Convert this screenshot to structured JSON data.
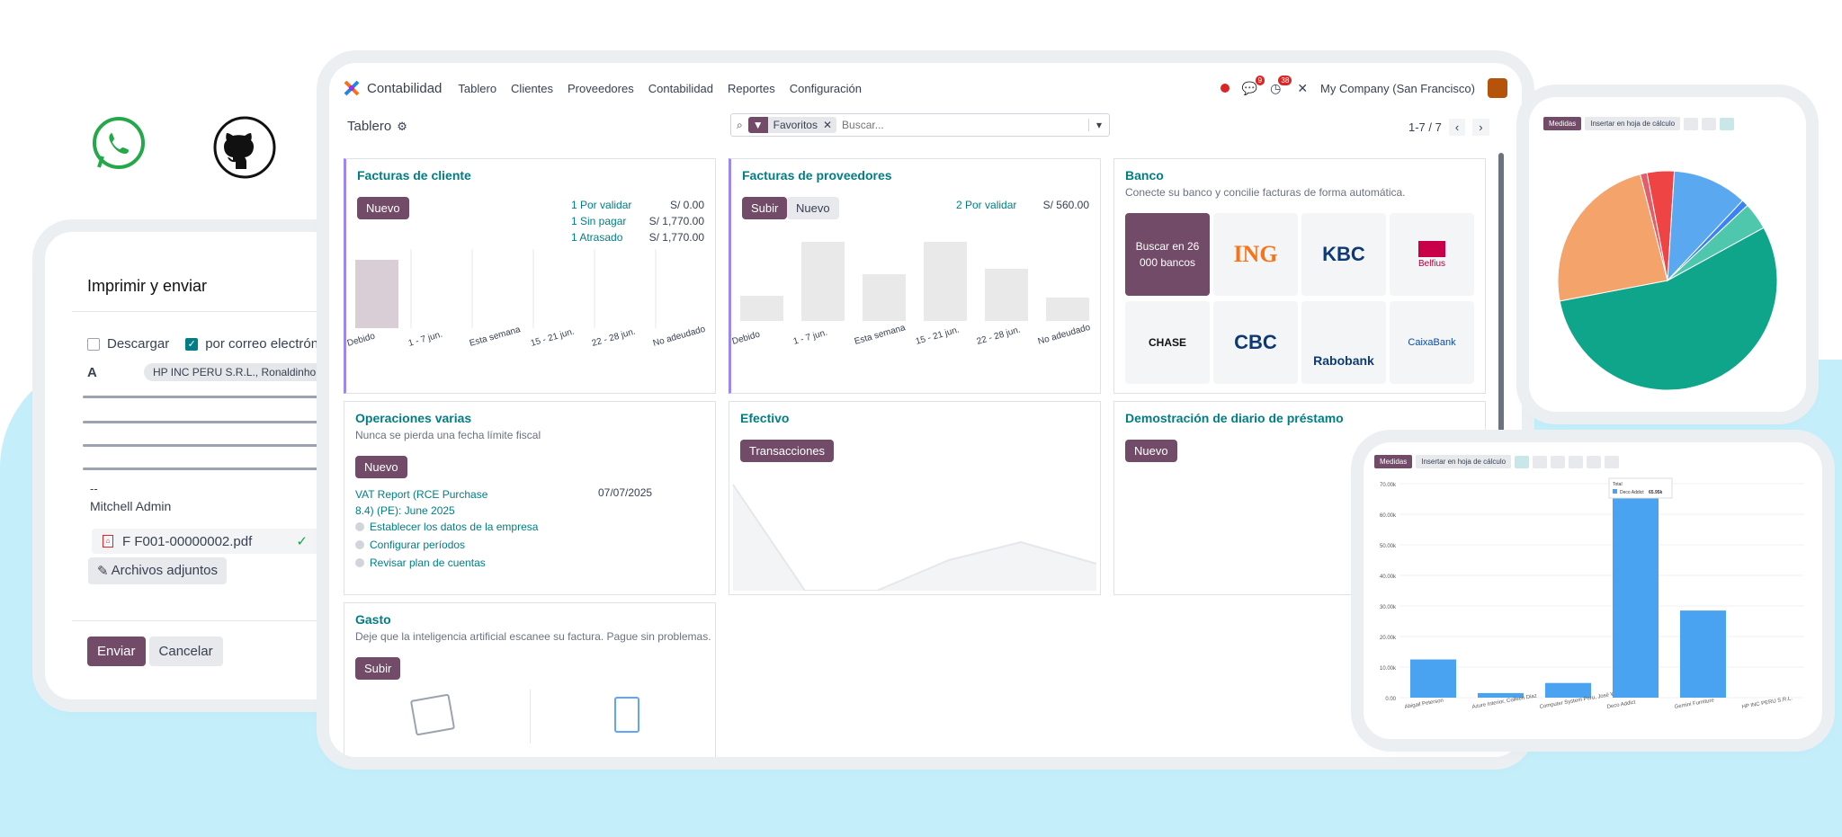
{
  "colors": {
    "brand": "#714b67",
    "teal": "#017e84",
    "blob": "#c5eefb",
    "bar": "#e9e9ea",
    "pink": "#d9cdd6"
  },
  "icons": [
    "whatsapp-icon",
    "github-icon",
    "filter-icon",
    "search-icon",
    "gear-icon",
    "chevron-left-icon",
    "chevron-right-icon",
    "pdf-icon",
    "paperclip-icon",
    "check-icon",
    "tools-icon",
    "clock-icon",
    "chat-icon"
  ],
  "app": {
    "title": "Contabilidad",
    "menu": [
      "Tablero",
      "Clientes",
      "Proveedores",
      "Contabilidad",
      "Reportes",
      "Configuración"
    ],
    "badge_chat": "9",
    "badge_activity": "38",
    "company": "My Company (San Francisco)",
    "breadcrumb": "Tablero",
    "filter_facet": "Favoritos",
    "search_placeholder": "Buscar...",
    "pager": "1-7 / 7"
  },
  "panels": {
    "customer": {
      "title": "Facturas de cliente",
      "btn": "Nuevo",
      "rows": [
        [
          "1 Por validar",
          "S/ 0.00"
        ],
        [
          "1 Sin pagar",
          "S/ 1,770.00"
        ],
        [
          "1 Atrasado",
          "S/ 1,770.00"
        ]
      ],
      "labels": [
        "Debido",
        "1 - 7 jun.",
        "Esta semana",
        "15 - 21 jun.",
        "22 - 28 jun.",
        "No adeudado"
      ]
    },
    "vendor": {
      "title": "Facturas de proveedores",
      "btn1": "Subir",
      "btn2": "Nuevo",
      "rows": [
        [
          "2 Por validar",
          "S/ 560.00"
        ]
      ],
      "labels": [
        "Debido",
        "1 - 7 jun.",
        "Esta semana",
        "15 - 21 jun.",
        "22 - 28 jun.",
        "No adeudado"
      ]
    },
    "bank": {
      "title": "Banco",
      "sub": "Conecte su banco y concilie facturas de forma automática.",
      "search": "Buscar en 26 000 bancos",
      "logos": [
        "ING",
        "KBC",
        "Belfius",
        "CHASE",
        "CBC",
        "Rabobank",
        "CaixaBank"
      ]
    },
    "misc": {
      "title": "Operaciones varias",
      "sub": "Nunca se pierda una fecha límite fiscal",
      "btn": "Nuevo",
      "report1": "VAT Report (RCE Purchase",
      "report2": "8.4) (PE): June 2025",
      "date": "07/07/2025",
      "steps": [
        "Establecer los datos de la empresa",
        "Configurar períodos",
        "Revisar plan de cuentas"
      ]
    },
    "cash": {
      "title": "Efectivo",
      "btn": "Transacciones"
    },
    "loan": {
      "title": "Demostración de diario de préstamo",
      "btn": "Nuevo"
    },
    "expense": {
      "title": "Gasto",
      "sub": "Deje que la inteligencia artificial escanee su factura. Pague sin problemas.",
      "btn": "Subir"
    }
  },
  "print": {
    "title": "Imprimir y enviar",
    "download": "Descargar",
    "email": "por correo electrónico",
    "to": "A",
    "partner": "HP INC PERU S.R.L., Ronaldinho Far",
    "sig_sep": "--",
    "signature": "Mitchell Admin",
    "file": "F F001-00000002.pdf",
    "attach": "Archivos adjuntos",
    "send": "Enviar",
    "cancel": "Cancelar"
  },
  "pie": {
    "toolbar_measures": "Medidas",
    "toolbar_insert": "Insertar en hoja de cálculo"
  },
  "bar": {
    "toolbar_measures": "Medidas",
    "toolbar_insert": "Insertar en hoja de cálculo",
    "tooltip_title": "Total",
    "tooltip_series": "Deco Addict",
    "tooltip_value": "65.95k"
  },
  "chart_data": [
    {
      "type": "bar",
      "title": "",
      "categories": [
        "Debido",
        "1 - 7 jun.",
        "Esta semana",
        "15 - 21 jun.",
        "22 - 28 jun.",
        "No adeudado"
      ],
      "values": [
        1770,
        0,
        0,
        0,
        0,
        0
      ],
      "note": "Facturas de cliente"
    },
    {
      "type": "pie",
      "series": [
        {
          "name": "",
          "values": [
            55,
            4,
            1,
            11,
            1,
            24,
            4
          ]
        }
      ],
      "colors": [
        "#0fa58a",
        "#4fc7ad",
        "#3b82f6",
        "#5aa9f0",
        "#e35d6a",
        "#f4a36b",
        "#ef4444"
      ]
    },
    {
      "type": "bar",
      "categories": [
        "Abigail Peterson",
        "Azure Interior, Colleen Diaz",
        "Computer System Peru, José Wil...",
        "Deco Addict",
        "Gemini Furniture",
        "HP INC PERU S.R.L."
      ],
      "values": [
        12.5,
        1.5,
        4.8,
        65.95,
        28.5,
        0
      ],
      "ylim": [
        0,
        70
      ],
      "yticks": [
        "0.00",
        "10.00k",
        "20.00k",
        "30.00k",
        "40.00k",
        "50.00k",
        "60.00k",
        "70.00k"
      ]
    }
  ]
}
